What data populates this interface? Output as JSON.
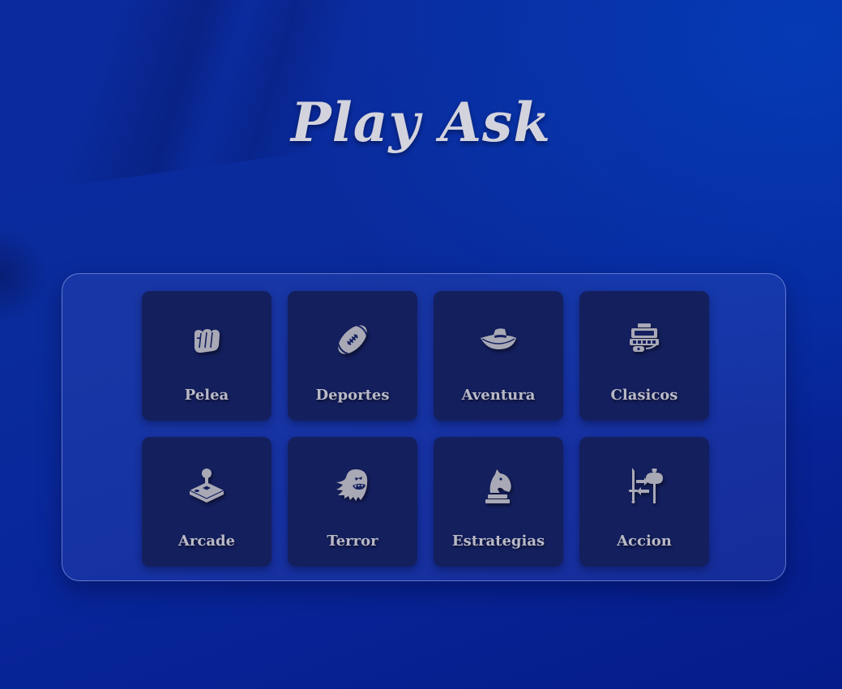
{
  "app": {
    "title": "Play Ask"
  },
  "colors": {
    "background": "#0a2b9c",
    "card": "#141f5e",
    "text": "#b9b9c6",
    "title": "#d3d3de",
    "icon": "#a9a9b6"
  },
  "categories": [
    {
      "label": "Pelea",
      "icon": "fist-icon"
    },
    {
      "label": "Deportes",
      "icon": "football-icon"
    },
    {
      "label": "Aventura",
      "icon": "hat-icon"
    },
    {
      "label": "Clasicos",
      "icon": "arcade-machine-icon"
    },
    {
      "label": "Arcade",
      "icon": "joystick-icon"
    },
    {
      "label": "Terror",
      "icon": "ghost-icon"
    },
    {
      "label": "Estrategias",
      "icon": "chess-knight-icon"
    },
    {
      "label": "Accion",
      "icon": "weapons-icon"
    }
  ]
}
